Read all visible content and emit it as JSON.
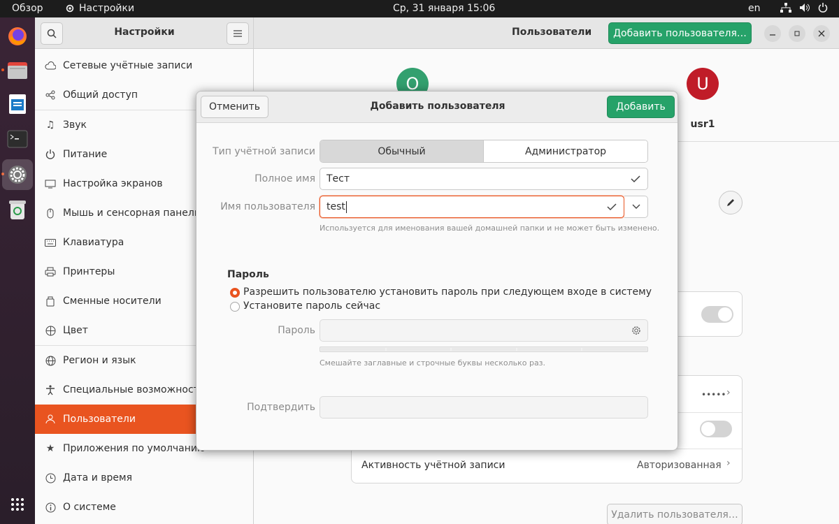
{
  "topbar": {
    "overview": "Обзор",
    "app_name": "Настройки",
    "clock": "Ср, 31 января  15:06",
    "lang": "en"
  },
  "dock": {
    "items": [
      "firefox-icon",
      "files-icon",
      "writer-icon",
      "terminal-icon",
      "settings-icon",
      "trash-icon",
      "app-grid-icon"
    ]
  },
  "header": {
    "sidebar_title": "Настройки",
    "main_title": "Пользователи",
    "add_user_button": "Добавить пользователя…"
  },
  "sidebar": {
    "items": [
      {
        "label": "Сетевые учётные записи",
        "icon": "cloud-icon"
      },
      {
        "label": "Общий доступ",
        "icon": "share-icon"
      },
      {
        "label": "Звук",
        "icon": "music-icon"
      },
      {
        "label": "Питание",
        "icon": "power-icon"
      },
      {
        "label": "Настройка экранов",
        "icon": "display-icon"
      },
      {
        "label": "Мышь и сенсорная панель",
        "icon": "mouse-icon"
      },
      {
        "label": "Клавиатура",
        "icon": "keyboard-icon"
      },
      {
        "label": "Принтеры",
        "icon": "printer-icon"
      },
      {
        "label": "Сменные носители",
        "icon": "media-icon"
      },
      {
        "label": "Цвет",
        "icon": "color-icon"
      },
      {
        "label": "Регион и язык",
        "icon": "globe-icon"
      },
      {
        "label": "Специальные возможности",
        "icon": "accessibility-icon"
      },
      {
        "label": "Пользователи",
        "icon": "users-icon"
      },
      {
        "label": "Приложения по умолчанию",
        "icon": "star-icon"
      },
      {
        "label": "Дата и время",
        "icon": "clock-icon"
      },
      {
        "label": "О системе",
        "icon": "info-icon"
      }
    ],
    "selected": "Пользователи"
  },
  "main": {
    "users": [
      {
        "initial": "O",
        "color": "#33a06f"
      },
      {
        "initial": "U",
        "color": "#c01c28",
        "name": "usr1"
      }
    ],
    "row_password_value": "•••••",
    "row_activity_label": "Активность учётной записи",
    "row_activity_value": "Авторизованная",
    "delete_user_button": "Удалить пользователя…"
  },
  "dialog": {
    "title": "Добавить пользователя",
    "cancel_button": "Отменить",
    "add_button": "Добавить",
    "account_type_label": "Тип учётной записи",
    "account_type_options": [
      "Обычный",
      "Администратор"
    ],
    "account_type_selected": "Обычный",
    "full_name_label": "Полное имя",
    "full_name_value": "Тест",
    "username_label": "Имя пользователя",
    "username_value": "test",
    "username_hint": "Используется для именования вашей домашней папки и не может быть изменено.",
    "password_section": "Пароль",
    "password_options": [
      "Разрешить пользователю установить пароль при следующем входе в систему",
      "Установите пароль сейчас"
    ],
    "password_option_selected": "Разрешить пользователю установить пароль при следующем входе в систему",
    "password_label": "Пароль",
    "password_hint": "Смешайте заглавные и строчные буквы несколько раз.",
    "confirm_label": "Подтвердить"
  },
  "colors": {
    "accent": "#e95420",
    "green": "#26a269"
  }
}
